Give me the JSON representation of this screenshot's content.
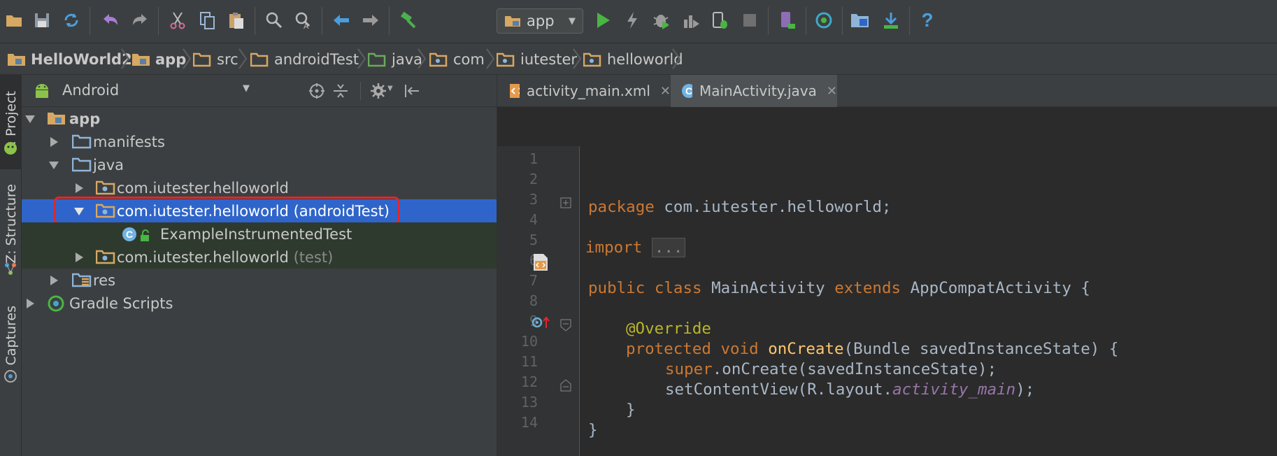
{
  "toolbar": {
    "run_config": "app",
    "buttons": [
      "open-icon",
      "save-icon",
      "sync-icon",
      "undo-icon",
      "redo-icon",
      "cut-icon",
      "copy-icon",
      "paste-icon",
      "find-icon",
      "replace-icon",
      "back-icon",
      "forward-icon",
      "make-icon",
      "run-icon",
      "apply-changes-icon",
      "debug-icon",
      "profile-icon",
      "attach-debugger-icon",
      "stop-icon",
      "avd-manager-icon",
      "sync-gradle-icon",
      "project-structure-icon",
      "sdk-manager-icon",
      "help-icon"
    ]
  },
  "breadcrumb": [
    {
      "label": "HelloWorld2",
      "bold": true
    },
    {
      "label": "app",
      "bold": true
    },
    {
      "label": "src",
      "bold": false
    },
    {
      "label": "androidTest",
      "bold": false
    },
    {
      "label": "java",
      "bold": false
    },
    {
      "label": "com",
      "bold": false
    },
    {
      "label": "iutester",
      "bold": false
    },
    {
      "label": "helloworld",
      "bold": false
    }
  ],
  "side_tabs": {
    "project": "1: Project",
    "structure": "Z: Structure",
    "captures": "Captures"
  },
  "panel": {
    "view_mode": "Android"
  },
  "tree": [
    {
      "label": "app",
      "bold": true
    },
    {
      "label": "manifests"
    },
    {
      "label": "java"
    },
    {
      "label": "com.iutester.helloworld"
    },
    {
      "label": "com.iutester.helloworld",
      "suffix": "(androidTest)"
    },
    {
      "label": "ExampleInstrumentedTest"
    },
    {
      "label": "com.iutester.helloworld",
      "suffix": "(test)"
    },
    {
      "label": "res"
    },
    {
      "label": "Gradle Scripts"
    }
  ],
  "editor": {
    "tabs": [
      {
        "label": "activity_main.xml",
        "active": false
      },
      {
        "label": "MainActivity.java",
        "active": true
      }
    ],
    "line_numbers": [
      "1",
      "2",
      "3",
      "4",
      "5",
      "6",
      "7",
      "8",
      "9",
      "10",
      "11",
      "12",
      "13",
      "14"
    ],
    "code": {
      "l1_kw": "package",
      "l1_rest": " com.iutester.helloworld;",
      "l3_kw": "import",
      "l3_fold": "...",
      "l6_kw1": "public class",
      "l6_name": " MainActivity ",
      "l6_kw2": "extends",
      "l6_rest": " AppCompatActivity {",
      "l8_an": "@Override",
      "l9_kw": "protected void",
      "l9_fn": "onCreate",
      "l9_rest": "(Bundle savedInstanceState) {",
      "l10_kw": "super",
      "l10_rest": ".onCreate(savedInstanceState);",
      "l11_pre": "setContentView(R.layout.",
      "l11_it": "activity_main",
      "l11_post": ");",
      "l12": "}",
      "l13": "}"
    }
  },
  "colors": {
    "selection": "#2f65ca",
    "highlight_border": "#e2262b",
    "keyword": "#cc7832",
    "annotation": "#bbb529",
    "function": "#ffc66d"
  }
}
